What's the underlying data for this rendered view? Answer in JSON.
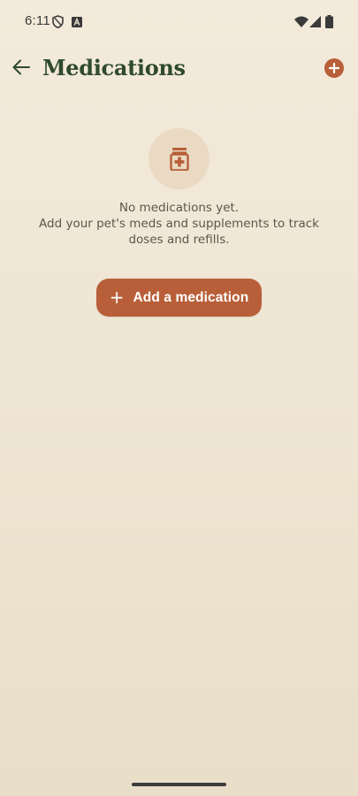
{
  "status_bar": {
    "time": "6:11",
    "icons": [
      "shield-icon",
      "font-a-icon",
      "wifi-icon",
      "cell-signal-icon",
      "battery-icon"
    ]
  },
  "app_bar": {
    "title": "Medications",
    "back_icon": "arrow-back-icon",
    "add_icon": "plus-circle-icon"
  },
  "empty_state": {
    "icon": "medicine-bottle-icon",
    "title": "No medications yet.",
    "description": "Add your pet's meds and supplements to track doses and refills."
  },
  "add_button": {
    "label": "Add a medication",
    "icon": "plus"
  },
  "colors": {
    "accent": "#b85f39",
    "title": "#2f4a2c",
    "icon_bg": "#ead9c3",
    "background": "#f3eadb"
  }
}
